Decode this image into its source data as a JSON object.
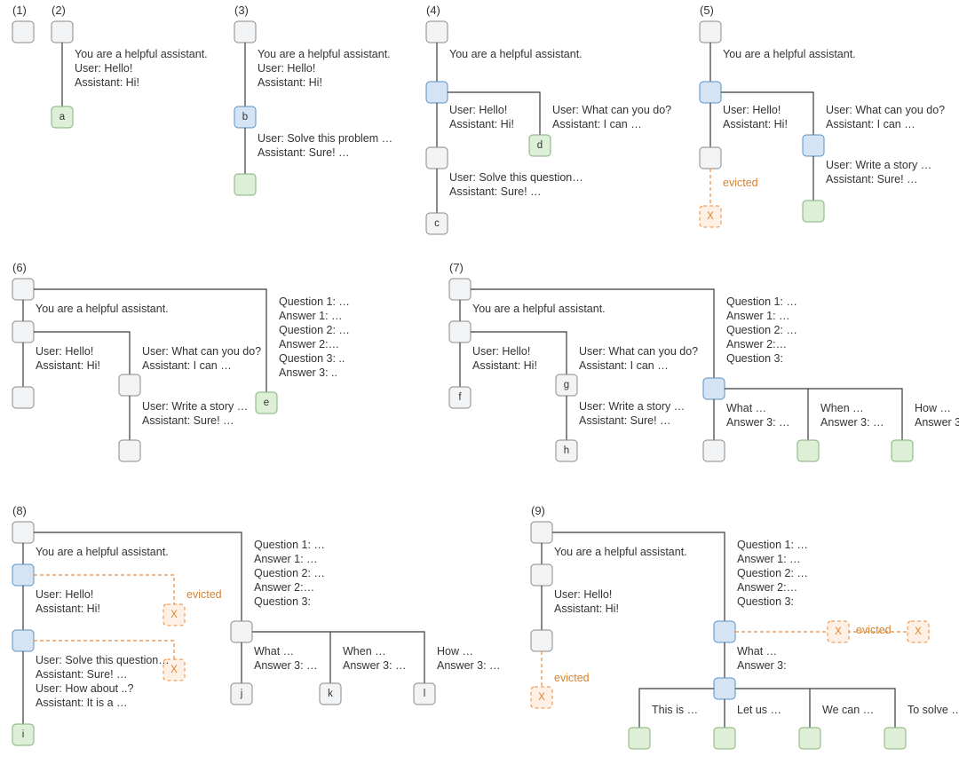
{
  "colors": {
    "gray": "#f2f3f4",
    "blue": "#d4e4f4",
    "green": "#deefd8",
    "evict_fill": "#fff0e5",
    "evict_stroke": "#e88b3c"
  },
  "common": {
    "system_prompt": "You are a helpful assistant.",
    "user_hello": "User: Hello!",
    "assist_hi": "Assistant: Hi!",
    "user_solve_problem": "User: Solve this problem …",
    "assist_sure": "Assistant: Sure! …",
    "user_solve_question": "User: Solve this question…",
    "user_whatcan": "User: What can you do?",
    "assist_ican": "Assistant: I can …",
    "user_write_story": "User: Write a story …",
    "evicted": "evicted",
    "q1": "Question 1: …",
    "a1": "Answer 1: …",
    "q2": "Question 2: …",
    "a2": "Answer 2:…",
    "q3dots": "Question 3: ..",
    "a3dots": "Answer 3: ..",
    "q3": "Question 3:",
    "what": "What …",
    "when": "When …",
    "how": "How …",
    "ans3ell": "Answer 3: …",
    "ans3colon": "Answer 3:",
    "user_howabout": "User: How about ..?",
    "assist_itis": "Assistant: It is a …",
    "thisis": "This is …",
    "letus": "Let us …",
    "wecan": "We can …",
    "tosolve": "To solve …"
  },
  "labels": {
    "a": "a",
    "b": "b",
    "c": "c",
    "d": "d",
    "e": "e",
    "f": "f",
    "g": "g",
    "h": "h",
    "i": "i",
    "j": "j",
    "k": "k",
    "l": "l",
    "X": "X"
  },
  "panels": {
    "p1": "(1)",
    "p2": "(2)",
    "p3": "(3)",
    "p4": "(4)",
    "p5": "(5)",
    "p6": "(6)",
    "p7": "(7)",
    "p8": "(8)",
    "p9": "(9)"
  },
  "panel_descriptions": {
    "1": "Single root gray node (empty cache).",
    "2": "Root → system prompt → Hello/Hi → green leaf 'a'.",
    "3": "Root → system prompt → Hello/Hi → blue 'b' → Solve this problem / Sure → green leaf.",
    "4": "Root → blue fork. Left: Hello/Hi → gray → Solve question/Sure → gray 'c'. Right: What can you do/I can → green 'd'.",
    "5": "Root → blue fork. Left: Hello/Hi → gray → evicted X (dashed orange). Right: What can you do/I can → blue → Write a story/Sure → green.",
    "6": "Root gray. Left branch: system prompt → gray → (Hello/Hi → gray) and (What can you do/I can → gray → Write a story/Sure → gray). Right branch: Q1..A3 → green 'e'.",
    "7": "Like (6) but right Q-branch forks at blue into What/When/How → gray/green/green; left leaves labeled f,g,h.",
    "8": "Left: blue chain with two orange evicted X's off to the right; deep chain Hello/Hi → Solve question/Sure → How about/It is a → green 'i'. Right Q-branch forks into j,k,l (gray).",
    "9": "Left simple Hello/Hi → gray → evicted X. Right Q-branch: blue (two evicted X to the right), then What/Answer3 → blue fork into This is/Let us/We can/To solve → four green leaves."
  }
}
